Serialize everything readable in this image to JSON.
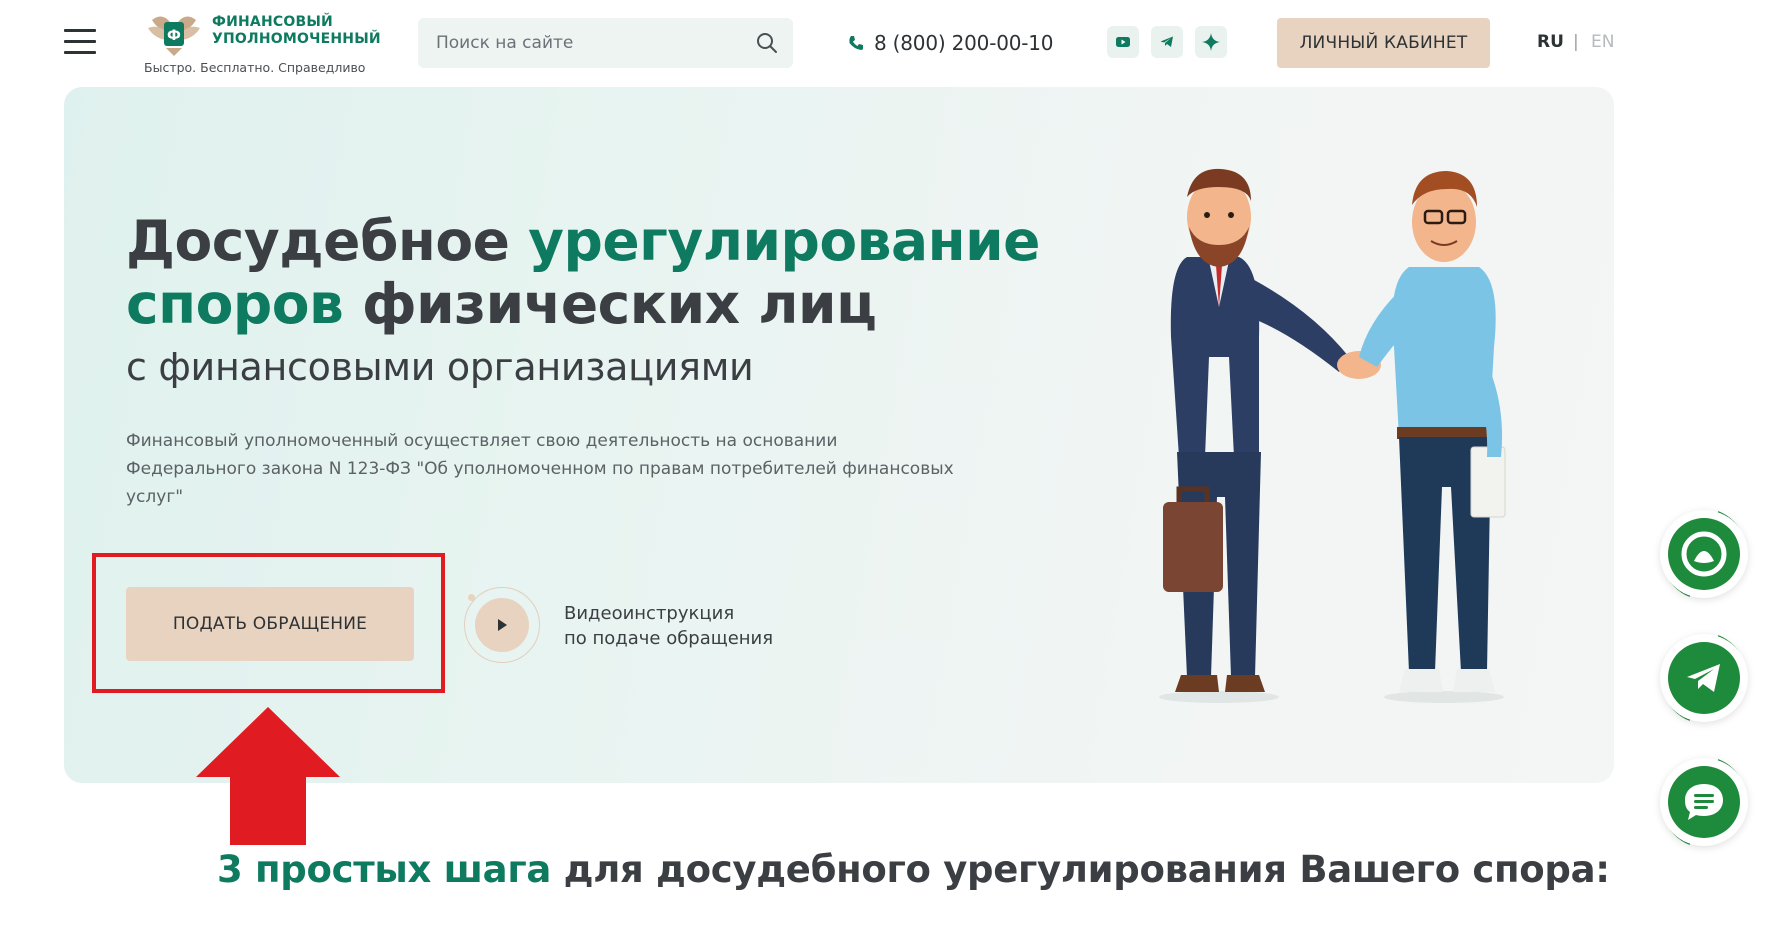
{
  "header": {
    "logo_name": "ФИНАНСОВЫЙ\nУПОЛНОМОЧЕННЫЙ",
    "logo_slogan": "Быстро. Бесплатно. Справедливо",
    "search_placeholder": "Поиск на сайте",
    "phone": "8 (800) 200-00-10",
    "social_icons": [
      "youtube-icon",
      "telegram-icon",
      "star-icon"
    ],
    "cabinet_label": "ЛИЧНЫЙ КАБИНЕТ",
    "lang_ru": "RU",
    "lang_sep": "|",
    "lang_en": "EN"
  },
  "hero": {
    "title_part1": "Досудебное ",
    "title_part2": "урегулирование",
    "title_part3": "споров",
    "title_part4": " физических лиц",
    "subtitle": "с финансовыми организациями",
    "description": "Финансовый уполномоченный осуществляет свою деятельность на основании Федерального закона N 123-ФЗ \"Об уполномоченном по правам потребителей финансовых услуг\"",
    "apply_button": "ПОДАТЬ ОБРАЩЕНИЕ",
    "video_line1": "Видеоинструкция",
    "video_line2": "по подаче обращения"
  },
  "steps_heading": {
    "highlight": "3 простых шага",
    "rest": " для досудебного урегулирования Вашего спора:"
  },
  "floating_buttons": [
    "alice-icon",
    "telegram-icon",
    "chat-icon"
  ],
  "colors": {
    "brand_green": "#0e7a5f",
    "accent_beige": "#e8d3c0",
    "annotation_red": "#e11b22",
    "float_green": "#1e8a3c"
  }
}
